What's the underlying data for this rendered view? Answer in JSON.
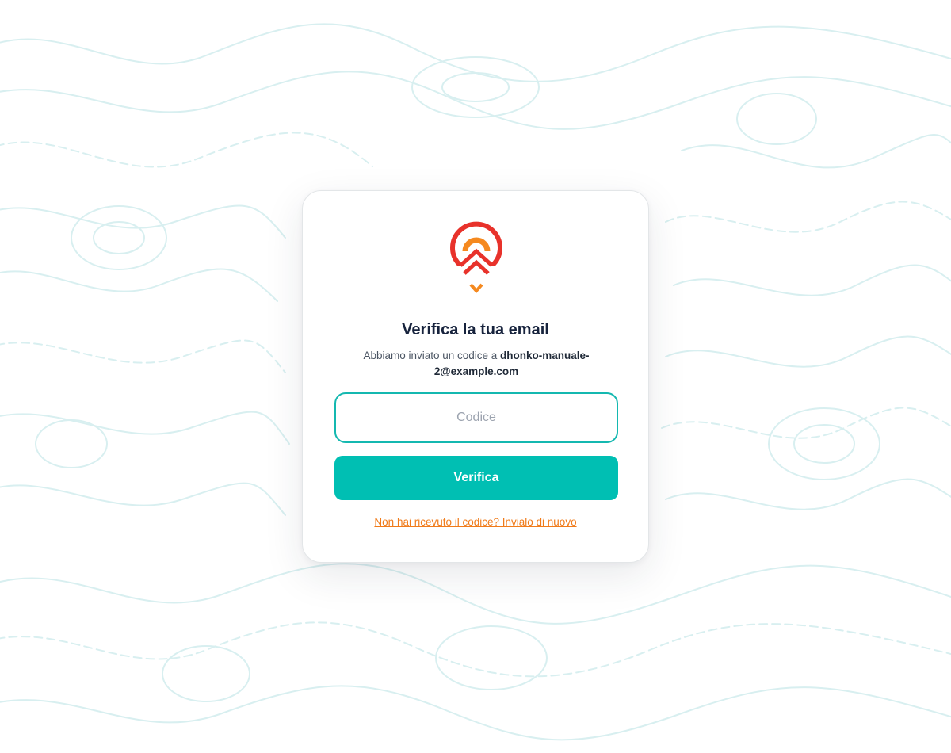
{
  "auth": {
    "title": "Verifica la tua email",
    "subtitle_prefix": "Abbiamo inviato un codice a ",
    "email": "dhonko-manuale-2@example.com",
    "code_placeholder": "Codice",
    "code_value": "",
    "verify_label": "Verifica",
    "resend_label": "Non hai ricevuto il codice? Invialo di nuovo"
  },
  "icons": {
    "logo": "map-pin-logo-icon"
  },
  "colors": {
    "accent": "#00bfb3",
    "input_border": "#14b8b0",
    "link": "#f07b1a",
    "title": "#17233d",
    "logo_red": "#e8322b",
    "logo_orange": "#f5891f",
    "background_pattern": "#d6efef"
  }
}
